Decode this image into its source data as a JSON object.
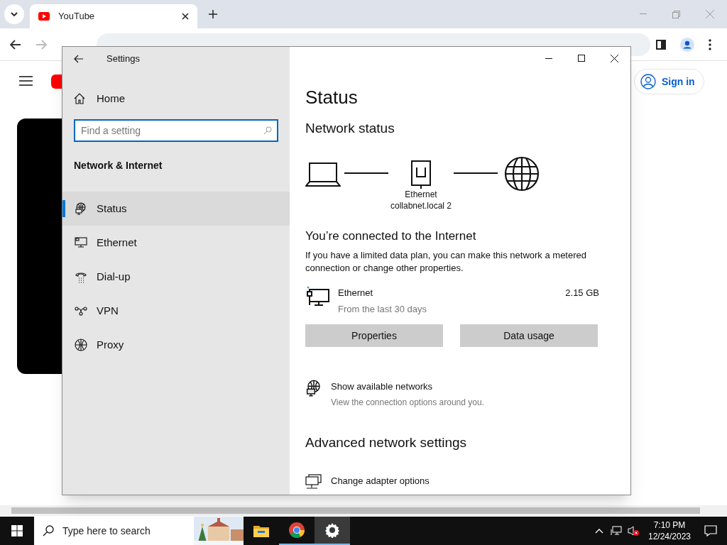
{
  "browser": {
    "tab_title": "YouTube",
    "sign_in": "Sign in"
  },
  "settings": {
    "title": "Settings",
    "home": "Home",
    "search": {
      "placeholder": "Find a setting"
    },
    "section": "Network & Internet",
    "nav": [
      {
        "label": "Status",
        "kind": "status",
        "selected": true
      },
      {
        "label": "Ethernet",
        "kind": "ethernet",
        "selected": false
      },
      {
        "label": "Dial-up",
        "kind": "dialup",
        "selected": false
      },
      {
        "label": "VPN",
        "kind": "vpn",
        "selected": false
      },
      {
        "label": "Proxy",
        "kind": "proxy",
        "selected": false
      }
    ],
    "page_title": "Status",
    "network_status": "Network status",
    "diagram": {
      "adapter": "Ethernet",
      "network": "collabnet.local 2"
    },
    "connected": "You’re connected to the Internet",
    "description": "If you have a limited data plan, you can make this network a metered connection or change other properties.",
    "connection": {
      "name": "Ethernet",
      "period": "From the last 30 days",
      "usage": "2.15 GB"
    },
    "buttons": [
      "Properties",
      "Data usage"
    ],
    "show_networks": {
      "title": "Show available networks",
      "subtitle": "View the connection options around you."
    },
    "advanced": "Advanced network settings",
    "adapter_options": {
      "title": "Change adapter options"
    }
  },
  "taskbar": {
    "search_placeholder": "Type here to search",
    "time": "7:10 PM",
    "date": "12/24/2023"
  }
}
